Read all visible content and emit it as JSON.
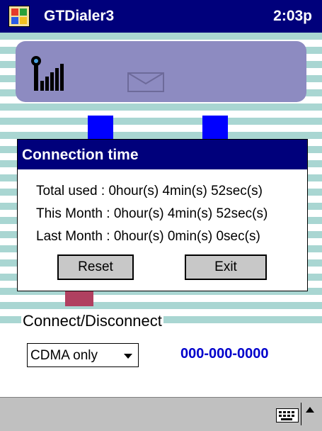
{
  "titlebar": {
    "app_title": "GTDialer3",
    "time": "2:03p"
  },
  "dialog": {
    "title": "Connection time",
    "total_used": "Total used : 0hour(s) 4min(s) 52sec(s)",
    "this_month": "This Month : 0hour(s) 4min(s) 52sec(s)",
    "last_month": "Last Month : 0hour(s) 0min(s) 0sec(s)",
    "reset_label": "Reset",
    "exit_label": "Exit"
  },
  "main": {
    "connect_label": "Connect/Disconnect"
  },
  "controls": {
    "mode_selected": "CDMA only",
    "phone_number": "000-000-0000"
  },
  "icons": {
    "start": "windows-flag-icon",
    "signal": "signal-strength-icon",
    "message": "envelope-icon",
    "keyboard": "keyboard-icon",
    "sip_arrow": "up-arrow-icon"
  },
  "colors": {
    "titlebar": "#00007b",
    "panel": "#8d8bc1",
    "stripe": "#a9d6d2",
    "phone": "#0000cc"
  }
}
